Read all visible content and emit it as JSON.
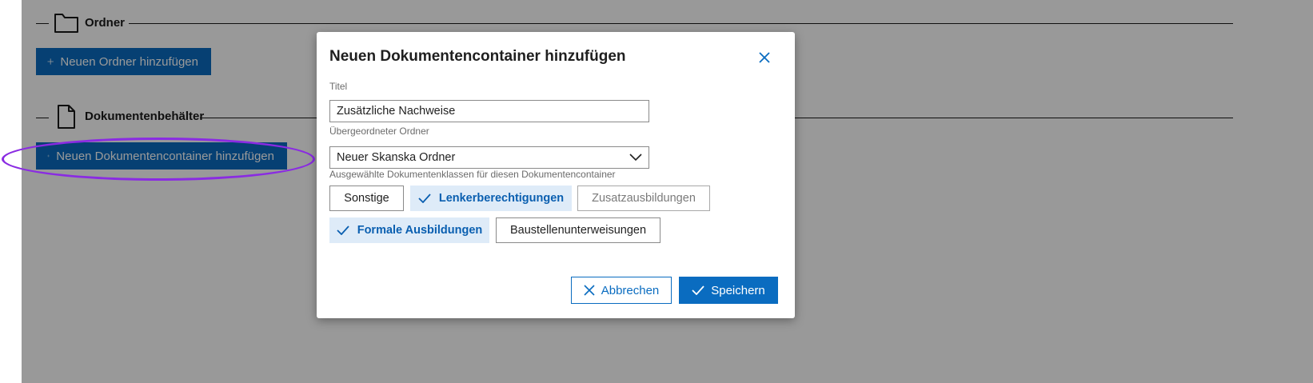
{
  "sections": {
    "folders": {
      "title": "Ordner",
      "icon": "folder-icon",
      "add_button_label": "Neuen Ordner hinzufügen"
    },
    "containers": {
      "title": "Dokumentenbehälter",
      "icon": "document-icon",
      "add_button_label": "Neuen Dokumentencontainer hinzufügen"
    }
  },
  "modal": {
    "title": "Neuen Dokumentencontainer hinzufügen",
    "close_icon": "close-icon",
    "title_label": "Titel",
    "title_value": "Zusätzliche Nachweise",
    "parent_label": "Übergeordneter Ordner",
    "parent_value": "Neuer Skanska Ordner",
    "classes_label": "Ausgewählte Dokumentenklassen für diesen Dokumentencontainer",
    "classes": [
      {
        "label": "Sonstige",
        "selected": false
      },
      {
        "label": "Lenkerberechtigungen",
        "selected": true
      },
      {
        "label": "Zusatzausbildungen",
        "selected": false
      },
      {
        "label": "Formale Ausbildungen",
        "selected": true
      },
      {
        "label": "Baustellenunterweisungen",
        "selected": false
      }
    ],
    "cancel_label": "Abbrechen",
    "save_label": "Speichern"
  },
  "colors": {
    "primary": "#0a6cc0",
    "chip_selected_bg": "#deebf8",
    "highlight": "#8a2be2",
    "overlay": "rgba(0,0,0,0.40)"
  }
}
